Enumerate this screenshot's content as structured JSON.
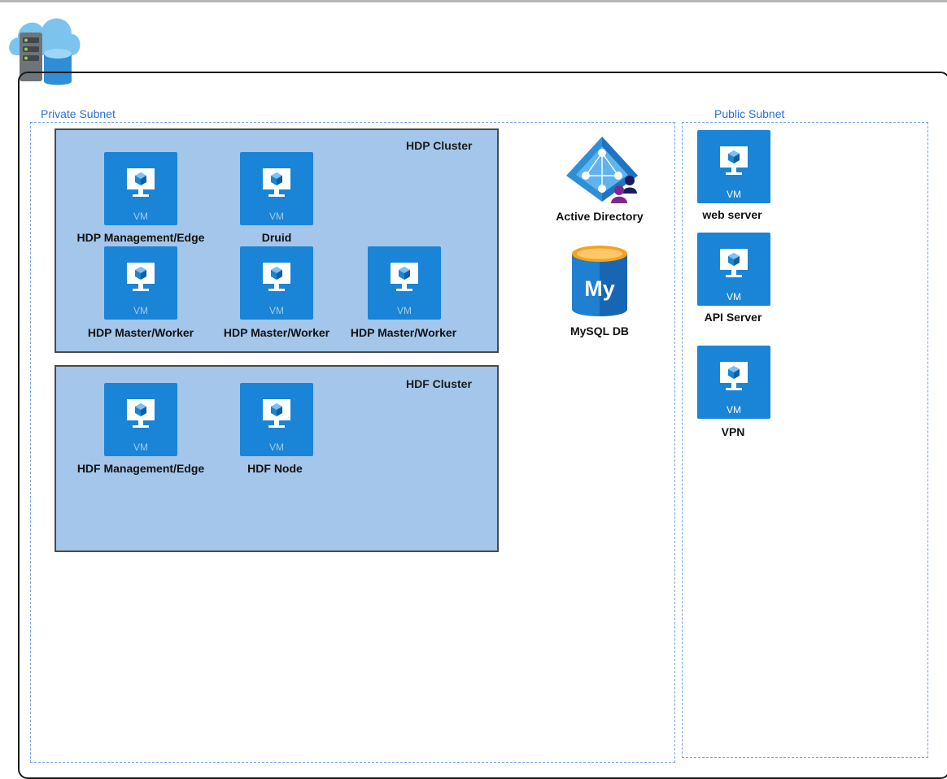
{
  "icons": {
    "network": "cloud-server-database-icon",
    "vm": "virtual-machine-monitor-icon",
    "directory": "azure-active-directory-icon",
    "database": "mysql-database-icon"
  },
  "colors": {
    "vm_tile": "#1a84d6",
    "cluster_fill": "#a3c6ea",
    "subnet_border": "#7aa5e3",
    "subnet_label": "#2d6fd8"
  },
  "subnets": {
    "private": {
      "label": "Private Subnet"
    },
    "public": {
      "label": "Public Subnet"
    }
  },
  "clusters": {
    "hdp": {
      "label": "HDP Cluster",
      "nodes": [
        {
          "vm": "VM",
          "label": "HDP Management/Edge"
        },
        {
          "vm": "VM",
          "label": "Druid"
        },
        {
          "vm": "VM",
          "label": "HDP Master/Worker"
        },
        {
          "vm": "VM",
          "label": "HDP Master/Worker"
        },
        {
          "vm": "VM",
          "label": "HDP Master/Worker"
        }
      ]
    },
    "hdf": {
      "label": "HDF Cluster",
      "nodes": [
        {
          "vm": "VM",
          "label": "HDF Management/Edge"
        },
        {
          "vm": "VM",
          "label": "HDF Node"
        }
      ]
    }
  },
  "services": {
    "active_directory": {
      "label": "Active Directory"
    },
    "mysql": {
      "label": "MySQL DB",
      "badge": "My"
    }
  },
  "public_nodes": [
    {
      "vm": "VM",
      "label": "web server"
    },
    {
      "vm": "VM",
      "label": "API Server"
    },
    {
      "vm": "VM",
      "label": "VPN"
    }
  ]
}
